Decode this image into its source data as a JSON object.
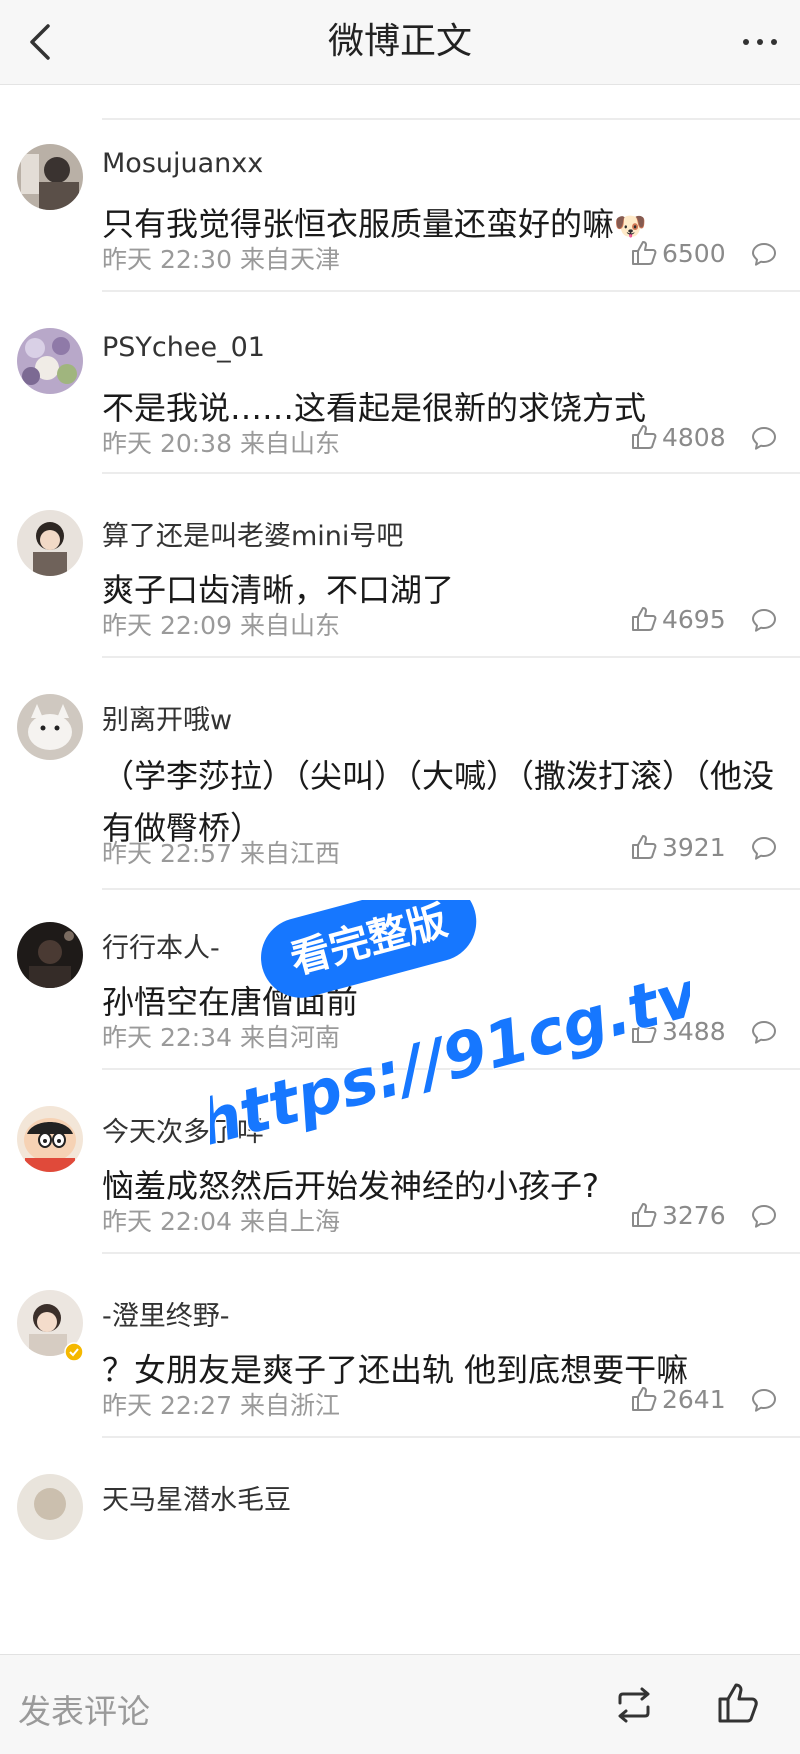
{
  "header": {
    "title": "微博正文",
    "back_icon": "chevron-left-icon",
    "more_icon": "more-dots-icon"
  },
  "comments": [
    {
      "username": "Mosujuanxx",
      "content": "只有我觉得张恒衣服质量还蛮好的嘛",
      "emoji": "🐶",
      "time": "昨天 22:30 来自天津",
      "likes": "6500"
    },
    {
      "username": "PSYchee_01",
      "content": "不是我说……这看起是很新的求饶方式",
      "time": "昨天 20:38 来自山东",
      "likes": "4808"
    },
    {
      "username": "算了还是叫老婆mini号吧",
      "content": "爽子口齿清晰，不口湖了",
      "time": "昨天 22:09 来自山东",
      "likes": "4695"
    },
    {
      "username": "别离开哦w",
      "content": "（学李莎拉）（尖叫）（大喊）（撒泼打滚）（他没有做臀桥）",
      "time": "昨天 22:57 来自江西",
      "likes": "3921"
    },
    {
      "username": "行行本人-",
      "content": "孙悟空在唐僧面前",
      "time": "昨天 22:34 来自河南",
      "likes": "3488"
    },
    {
      "username": "今天次多了咩",
      "content": "恼羞成怒然后开始发神经的小孩子?",
      "time": "昨天 22:04 来自上海",
      "likes": "3276"
    },
    {
      "username": "-澄里终野-",
      "content": "？女朋友是爽子了还出轨 他到底想要干嘛",
      "time": "昨天 22:27 来自浙江",
      "likes": "2641"
    },
    {
      "username": "天马星潜水毛豆"
    }
  ],
  "watermark": {
    "badge": "看完整版",
    "url": "https://91cg.tv",
    "color": "#1677ff"
  },
  "bottom_bar": {
    "placeholder": "发表评论",
    "repost_icon": "repost-icon",
    "like_icon": "thumb-up-icon"
  }
}
